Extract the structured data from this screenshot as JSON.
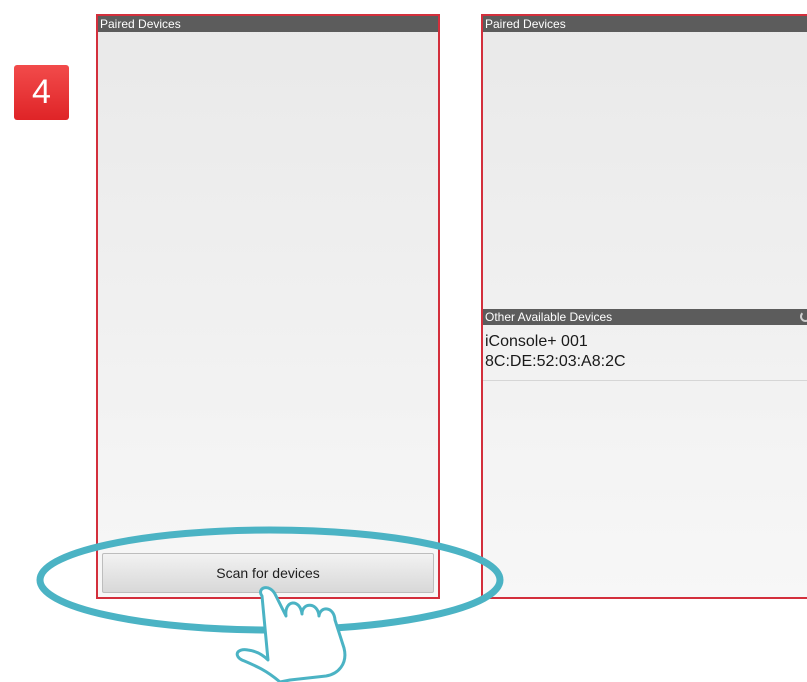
{
  "step": {
    "number": "4"
  },
  "left_screen": {
    "paired_header": "Paired Devices",
    "scan_button_label": "Scan for devices"
  },
  "right_screen": {
    "paired_header": "Paired Devices",
    "other_header": "Other Available Devices",
    "devices": [
      {
        "name": "iConsole+ 001",
        "mac": "8C:DE:52:03:A8:2C"
      }
    ]
  },
  "colors": {
    "accent_red": "#d32f3c",
    "highlight_teal": "#4bb3c4",
    "header_gray": "#5c5c5c"
  },
  "icons": [
    "tap-hand-icon",
    "progress-spinner-icon"
  ]
}
